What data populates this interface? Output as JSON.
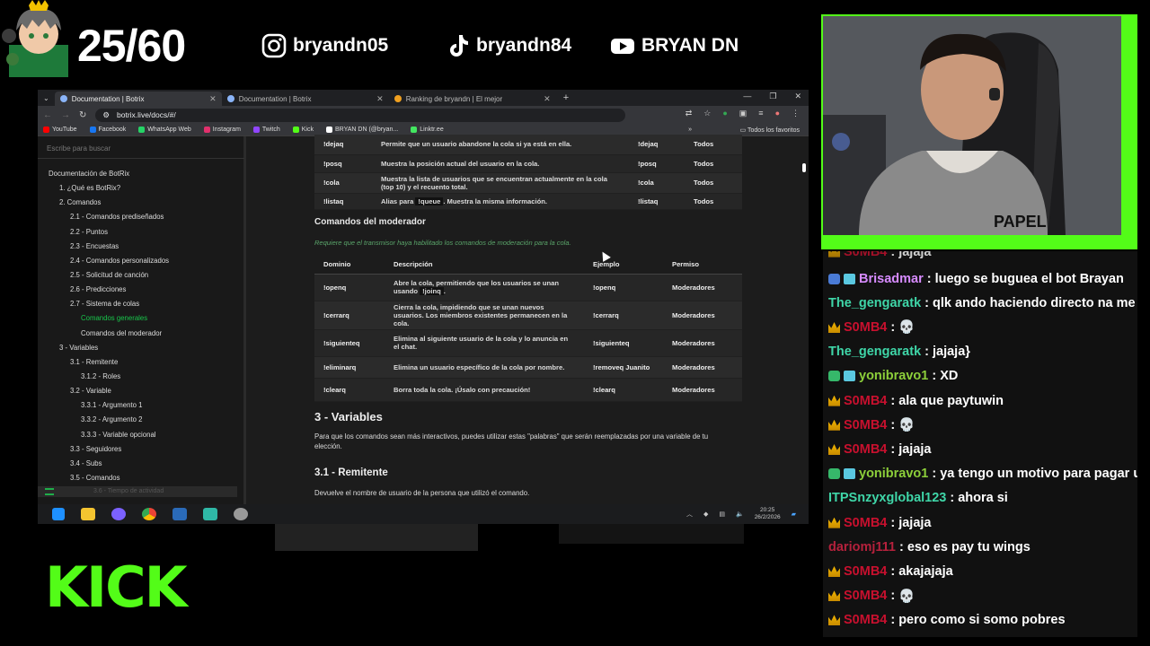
{
  "overlay": {
    "counter": "25/60",
    "socials": [
      {
        "icon": "instagram-icon",
        "handle": "bryandn05"
      },
      {
        "icon": "tiktok-icon",
        "handle": "bryandn84"
      },
      {
        "icon": "youtube-icon",
        "handle": "BRYAN DN"
      }
    ],
    "platform_logo": "KICK",
    "accent_color": "#53fc18"
  },
  "browser": {
    "tabs": [
      {
        "label": "Documentation | Botrix",
        "active": true
      },
      {
        "label": "Documentation | Botrix",
        "active": false
      },
      {
        "label": "Ranking de bryandn | El mejor",
        "active": false
      }
    ],
    "new_tab": "+",
    "url": "botrix.live/docs/#/",
    "bookmarks": [
      {
        "label": "YouTube",
        "color": "#ff0000"
      },
      {
        "label": "Facebook",
        "color": "#1877f2"
      },
      {
        "label": "WhatsApp Web",
        "color": "#25d366"
      },
      {
        "label": "Instagram",
        "color": "#e1306c"
      },
      {
        "label": "Twitch",
        "color": "#9146ff"
      },
      {
        "label": "Kick",
        "color": "#53fc18"
      },
      {
        "label": "BRYAN DN (@bryan...",
        "color": "#ffffff"
      },
      {
        "label": "Linktr.ee",
        "color": "#43e660"
      }
    ],
    "bookmarks_more": "»",
    "all_bookmarks": "Todos los favoritos",
    "sidebar": {
      "search_placeholder": "Escribe para buscar",
      "toc": [
        {
          "label": "Documentación de BotRix",
          "indent": 0
        },
        {
          "label": "1. ¿Qué es BotRix?",
          "indent": 1
        },
        {
          "label": "2. Comandos",
          "indent": 1
        },
        {
          "label": "2.1 - Comandos prediseñados",
          "indent": 2
        },
        {
          "label": "2.2 - Puntos",
          "indent": 2
        },
        {
          "label": "2.3 - Encuestas",
          "indent": 2
        },
        {
          "label": "2.4 - Comandos personalizados",
          "indent": 2
        },
        {
          "label": "2.5 - Solicitud de canción",
          "indent": 2
        },
        {
          "label": "2.6 - Predicciones",
          "indent": 2
        },
        {
          "label": "2.7 - Sistema de colas",
          "indent": 2
        },
        {
          "label": "Comandos generales",
          "indent": 3,
          "active": true
        },
        {
          "label": "Comandos del moderador",
          "indent": 3
        },
        {
          "label": "3 - Variables",
          "indent": 1
        },
        {
          "label": "3.1 - Remitente",
          "indent": 2
        },
        {
          "label": "3.1.2 - Roles",
          "indent": 3
        },
        {
          "label": "3.2 - Variable",
          "indent": 2
        },
        {
          "label": "3.3.1 - Argumento 1",
          "indent": 3
        },
        {
          "label": "3.3.2 - Argumento 2",
          "indent": 3
        },
        {
          "label": "3.3.3 - Variable opcional",
          "indent": 3
        },
        {
          "label": "3.3 - Seguidores",
          "indent": 2
        },
        {
          "label": "3.4 - Subs",
          "indent": 2
        },
        {
          "label": "3.5 - Comandos",
          "indent": 2
        }
      ],
      "bottom_item": "3.6 - Tiempo de actividad"
    },
    "general_table": [
      {
        "cmd": "!dejaq",
        "desc": "Permite que un usuario abandone la cola si ya está en ella.",
        "example": "!dejaq",
        "perm": "Todos"
      },
      {
        "cmd": "!posq",
        "desc": "Muestra la posición actual del usuario en la cola.",
        "example": "!posq",
        "perm": "Todos"
      },
      {
        "cmd": "!cola",
        "desc": "Muestra la lista de usuarios que se encuentran actualmente en la cola (top 10) y el recuento total.",
        "example": "!cola",
        "perm": "Todos"
      },
      {
        "cmd": "!listaq",
        "desc_pre": "Alias para ",
        "desc_code": "!queue",
        "desc_post": ". Muestra la misma información.",
        "example": "!listaq",
        "perm": "Todos"
      }
    ],
    "mod_heading": "Comandos del moderador",
    "mod_note": "Requiere que el transmisor haya habilitado los comandos de moderación para la cola.",
    "mod_headers": [
      "Dominio",
      "Descripción",
      "Ejemplo",
      "Permiso"
    ],
    "mod_table": [
      {
        "cmd": "!openq",
        "desc_pre": "Abre la cola, permitiendo que los usuarios se unan usando ",
        "desc_code": "!joinq",
        "desc_post": ".",
        "example": "!openq",
        "perm": "Moderadores"
      },
      {
        "cmd": "!cerrarq",
        "desc": "Cierra la cola, impidiendo que se unan nuevos usuarios. Los miembros existentes permanecen en la cola.",
        "example": "!cerrarq",
        "perm": "Moderadores"
      },
      {
        "cmd": "!siguienteq",
        "desc": "Elimina al siguiente usuario de la cola y lo anuncia en el chat.",
        "example": "!siguienteq",
        "perm": "Moderadores"
      },
      {
        "cmd": "!eliminarq",
        "desc": "Elimina un usuario específico de la cola por nombre.",
        "example": "!removeq Juanito",
        "perm": "Moderadores"
      },
      {
        "cmd": "!clearq",
        "desc": "Borra toda la cola. ¡Úsalo con precaución!",
        "example": "!clearq",
        "perm": "Moderadores"
      }
    ],
    "section3_title": "3 - Variables",
    "section3_text": "Para que los comandos sean más interactivos, puedes utilizar estas \"palabras\" que serán reemplazadas por una variable de tu elección.",
    "section31_title": "3.1 - Remitente",
    "section31_text": "Devuelve el nombre de usuario de la persona que utilizó el comando."
  },
  "taskbar": {
    "time": "20:25",
    "date": "26/2/2026"
  },
  "chat": [
    {
      "user": "Brisadmar",
      "color": "#d78bff",
      "badge": "multi",
      "text": "luego se buguea el bot Brayan"
    },
    {
      "user": "The_gengaratk",
      "color": "#3fd6a8",
      "badge": "",
      "text": "qlk ando haciendo directo na me"
    },
    {
      "user": "S0MB4",
      "color": "#c8102e",
      "badge": "crown",
      "text": "💀"
    },
    {
      "user": "The_gengaratk",
      "color": "#3fd6a8",
      "badge": "",
      "text": "jajaja}"
    },
    {
      "user": "yonibravo1",
      "color": "#8ccf3a",
      "badge": "multi2",
      "text": "XD"
    },
    {
      "user": "S0MB4",
      "color": "#c8102e",
      "badge": "crown",
      "text": "ala que paytuwin"
    },
    {
      "user": "S0MB4",
      "color": "#c8102e",
      "badge": "crown",
      "text": "💀"
    },
    {
      "user": "S0MB4",
      "color": "#c8102e",
      "badge": "crown",
      "text": "jajaja"
    },
    {
      "user": "yonibravo1",
      "color": "#8ccf3a",
      "badge": "multi2",
      "text": "ya tengo un motivo para pagar u"
    },
    {
      "user": "ITPSnzyxglobal123",
      "color": "#3fd6a8",
      "badge": "",
      "text": "ahora si"
    },
    {
      "user": "S0MB4",
      "color": "#c8102e",
      "badge": "crown",
      "text": "jajaja"
    },
    {
      "user": "dariomj111",
      "color": "#b5213c",
      "badge": "",
      "text": "eso es pay tu wings"
    },
    {
      "user": "S0MB4",
      "color": "#c8102e",
      "badge": "crown",
      "text": "akajajaja"
    },
    {
      "user": "S0MB4",
      "color": "#c8102e",
      "badge": "crown",
      "text": "💀"
    },
    {
      "user": "S0MB4",
      "color": "#c8102e",
      "badge": "crown",
      "text": "pero como si somo pobres"
    }
  ]
}
